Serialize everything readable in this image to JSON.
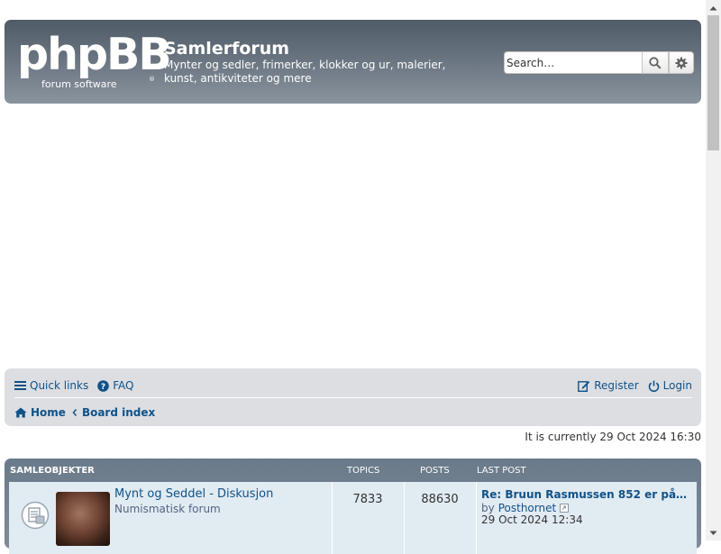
{
  "header": {
    "logo_text": "phpBB",
    "logo_subtext": "forum software",
    "logo_mark": "®",
    "site_title": "Samlerforum",
    "site_description": "Mynter og sedler, frimerker, klokker og ur, malerier, kunst, antikviteter og mere",
    "search_placeholder": "Search…",
    "icons": [
      "search-icon",
      "gear-icon"
    ]
  },
  "navbar": {
    "quick_links": "Quick links",
    "faq": "FAQ",
    "register": "Register",
    "login": "Login",
    "breadcrumb": [
      "Home",
      "Board index"
    ]
  },
  "current_time": "It is currently 29 Oct 2024 16:30",
  "forum_section": {
    "title": "SAMLEOBJEKTER",
    "columns": {
      "topics": "TOPICS",
      "posts": "POSTS",
      "last_post": "LAST POST"
    },
    "forums": [
      {
        "name": "Mynt og Seddel - Diskusjon",
        "description": "Numismatisk forum",
        "topics": "7833",
        "posts": "88630",
        "last_post_title": "Re: Bruun Rasmussen 852 er på…",
        "last_post_by_prefix": "by",
        "last_post_author": "Posthornet",
        "last_post_date": "29 Oct 2024 12:34"
      }
    ]
  },
  "colors": {
    "link": "#105289",
    "header_top": "#4f5b66",
    "header_bottom": "#8a949e",
    "navbar_bg": "#dcdee2",
    "row_bg": "#e1ebf2"
  }
}
